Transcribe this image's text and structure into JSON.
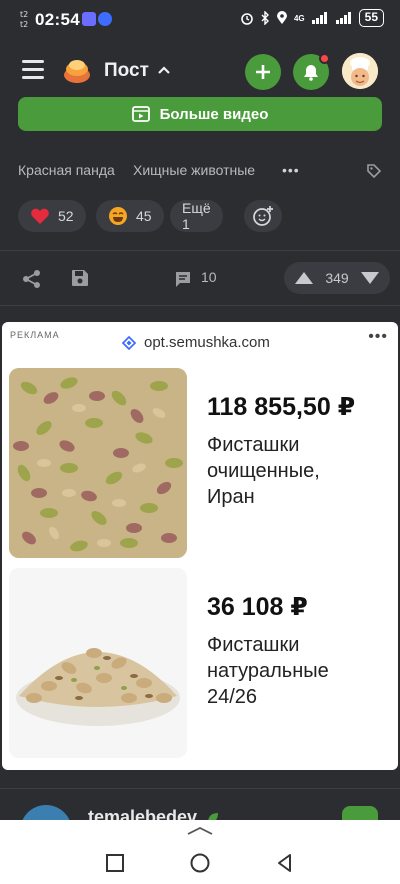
{
  "status_bar": {
    "carrier_top": "t2",
    "carrier_bottom": "t2",
    "time": "02:54",
    "network": "4G",
    "battery": "55"
  },
  "header": {
    "title": "Пост",
    "icons": [
      "menu-icon",
      "pikabu-logo",
      "chevron-up-icon",
      "plus-icon",
      "bell-icon",
      "avatar"
    ]
  },
  "post": {
    "more_video_label": "Больше видео",
    "tags": [
      "Красная панда",
      "Хищные животные"
    ],
    "tags_more": "•••",
    "reactions": [
      {
        "icon": "heart-icon",
        "count": "52"
      },
      {
        "icon": "laughing-face-icon",
        "count": "45"
      }
    ],
    "reactions_more": "Ещё 1",
    "comments_count": "10",
    "rating": "349"
  },
  "ad": {
    "label": "РЕКЛАМА",
    "domain": "opt.semushka.com",
    "menu": "•••",
    "products": [
      {
        "price": "118 855,50 ₽",
        "name_lines": [
          "Фисташки",
          "очищенные,",
          "Иран"
        ]
      },
      {
        "price": "36 108 ₽",
        "name_lines": [
          "Фисташки",
          "натуральные",
          "24/26"
        ]
      }
    ]
  },
  "next_post": {
    "author": "temalebedev"
  },
  "colors": {
    "background": "#2b2d31",
    "accent_green": "#4a9b3b",
    "notification_red": "#ff4545"
  }
}
